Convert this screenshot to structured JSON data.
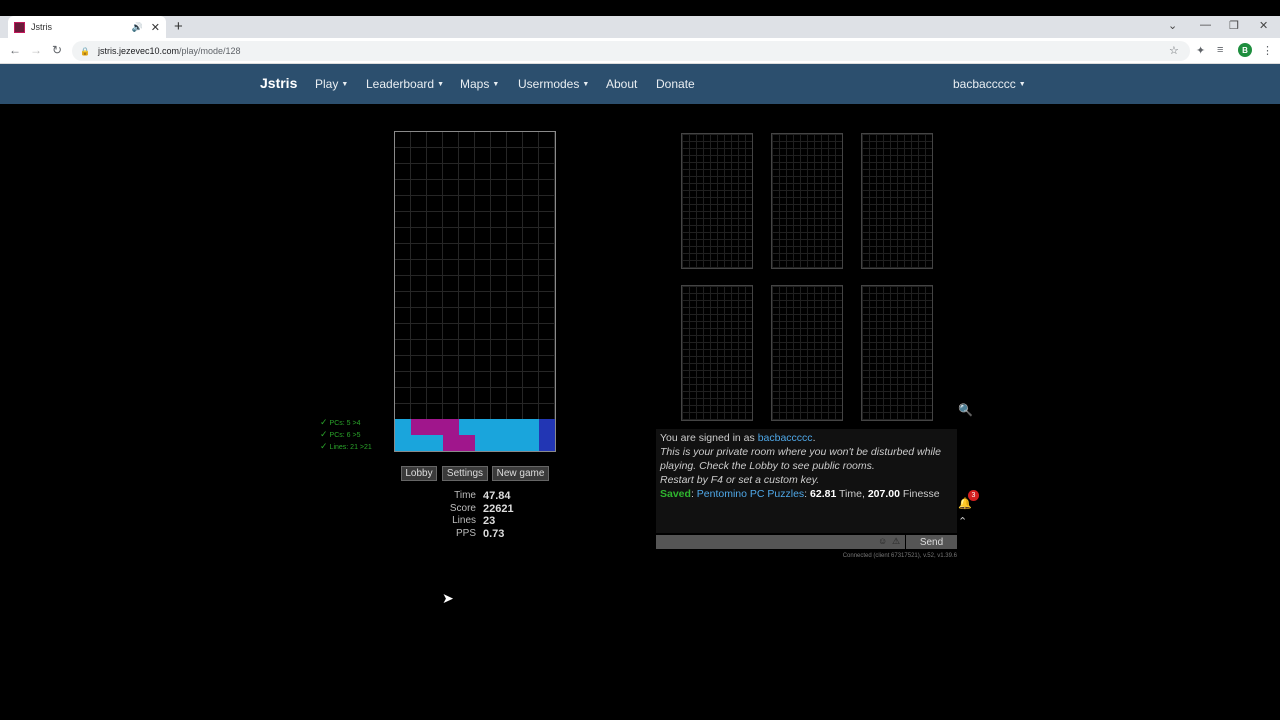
{
  "browser": {
    "tab_title": "Jstris",
    "url_host": "jstris.jezevec10.com",
    "url_path": "/play/mode/128",
    "profile_initial": "B"
  },
  "navbar": {
    "brand": "Jstris",
    "items": [
      "Play",
      "Leaderboard",
      "Maps",
      "Usermodes",
      "About",
      "Donate"
    ],
    "user": "bacbaccccc"
  },
  "board": {
    "colors": {
      "magenta": "#a0168c",
      "cyan": "#1aa5dc",
      "blue": "#2236b4"
    }
  },
  "checklist": [
    "PCs: 5 >4",
    "PCs: 6 >5",
    "Lines: 21 >21"
  ],
  "buttons": {
    "lobby": "Lobby",
    "settings": "Settings",
    "new_game": "New game"
  },
  "stats": [
    {
      "label": "Time",
      "value": "47.84"
    },
    {
      "label": "Score",
      "value": "22621"
    },
    {
      "label": "Lines",
      "value": "23"
    },
    {
      "label": "PPS",
      "value": "0.73"
    }
  ],
  "chat": {
    "signed_prefix": "You are signed in as",
    "username": "bacbaccccc",
    "private_msg": "This is your private room where you won't be disturbed while playing. Check the Lobby to see public rooms.",
    "restart_msg": "Restart by F4 or set a custom key.",
    "saved_label": "Saved",
    "mode_name": "Pentomino PC Puzzles",
    "time_value": "62.81",
    "time_label": "Time,",
    "finesse_value": "207.00",
    "finesse_label": "Finesse",
    "send": "Send",
    "connection": "Connected (client 67317521), v.52, v1.39.6",
    "notif_count": "3"
  }
}
